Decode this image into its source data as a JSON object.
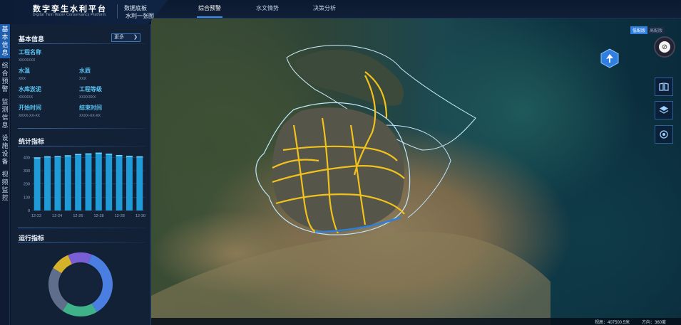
{
  "app": {
    "title": "数字孪生水利平台",
    "subtitle": "Digital Twin Water Conservancy Platform",
    "sub_title_1": "数据底板",
    "sub_title_2": "水利一张图"
  },
  "tabs": [
    {
      "label": "综合预警",
      "active": true
    },
    {
      "label": "水文情势",
      "active": false
    },
    {
      "label": "决策分析",
      "active": false
    }
  ],
  "left_nav": [
    {
      "label": "基本信息",
      "active": true
    },
    {
      "label": "综合预警",
      "active": false
    },
    {
      "label": "监测信息",
      "active": false
    },
    {
      "label": "设施设备",
      "active": false
    },
    {
      "label": "视频监控",
      "active": false
    }
  ],
  "basic_info": {
    "title": "基本信息",
    "more_label": "更多",
    "fields": [
      {
        "label": "工程名称",
        "value": "XXXXXXX"
      },
      {
        "label": "水温",
        "value": "XXX"
      },
      {
        "label": "水质",
        "value": "XXX"
      },
      {
        "label": "水库淤泥",
        "value": "XXXXXX"
      },
      {
        "label": "工程等级",
        "value": "XXXXXXX"
      },
      {
        "label": "开始时间",
        "value": "XXXX-XX-XX"
      },
      {
        "label": "结束时间",
        "value": "XXXX-XX-XX"
      }
    ]
  },
  "stats": {
    "title": "统计指标",
    "chart_data": {
      "type": "bar",
      "y_ticks": [
        "0",
        "100",
        "200",
        "300",
        "400"
      ],
      "ylim": [
        0,
        450
      ],
      "x_tick_labels": [
        "12-22",
        "12-24",
        "12-26",
        "12-28",
        "12-28",
        "12-30"
      ],
      "values": [
        400,
        408,
        410,
        416,
        426,
        430,
        436,
        428,
        418,
        412,
        408
      ]
    }
  },
  "ops": {
    "title": "运行指标",
    "chart_data": {
      "type": "pie",
      "slices": [
        {
          "value": 36,
          "color": "#4a7ee0"
        },
        {
          "value": 18,
          "color": "#3fb28a"
        },
        {
          "value": 24,
          "color": "#5f6e8a"
        },
        {
          "value": 10,
          "color": "#d6b12a"
        },
        {
          "value": 12,
          "color": "#7a5ed6"
        }
      ]
    }
  },
  "map": {
    "mode_on": "低配版",
    "mode_off": "高配版"
  },
  "statusbar": {
    "view_height": "视高：407500.5米",
    "direction": "方向：360度"
  },
  "colors": {
    "accent": "#2f7fe0",
    "river": "#f1c21b",
    "boundary": "#bfe8ff"
  }
}
